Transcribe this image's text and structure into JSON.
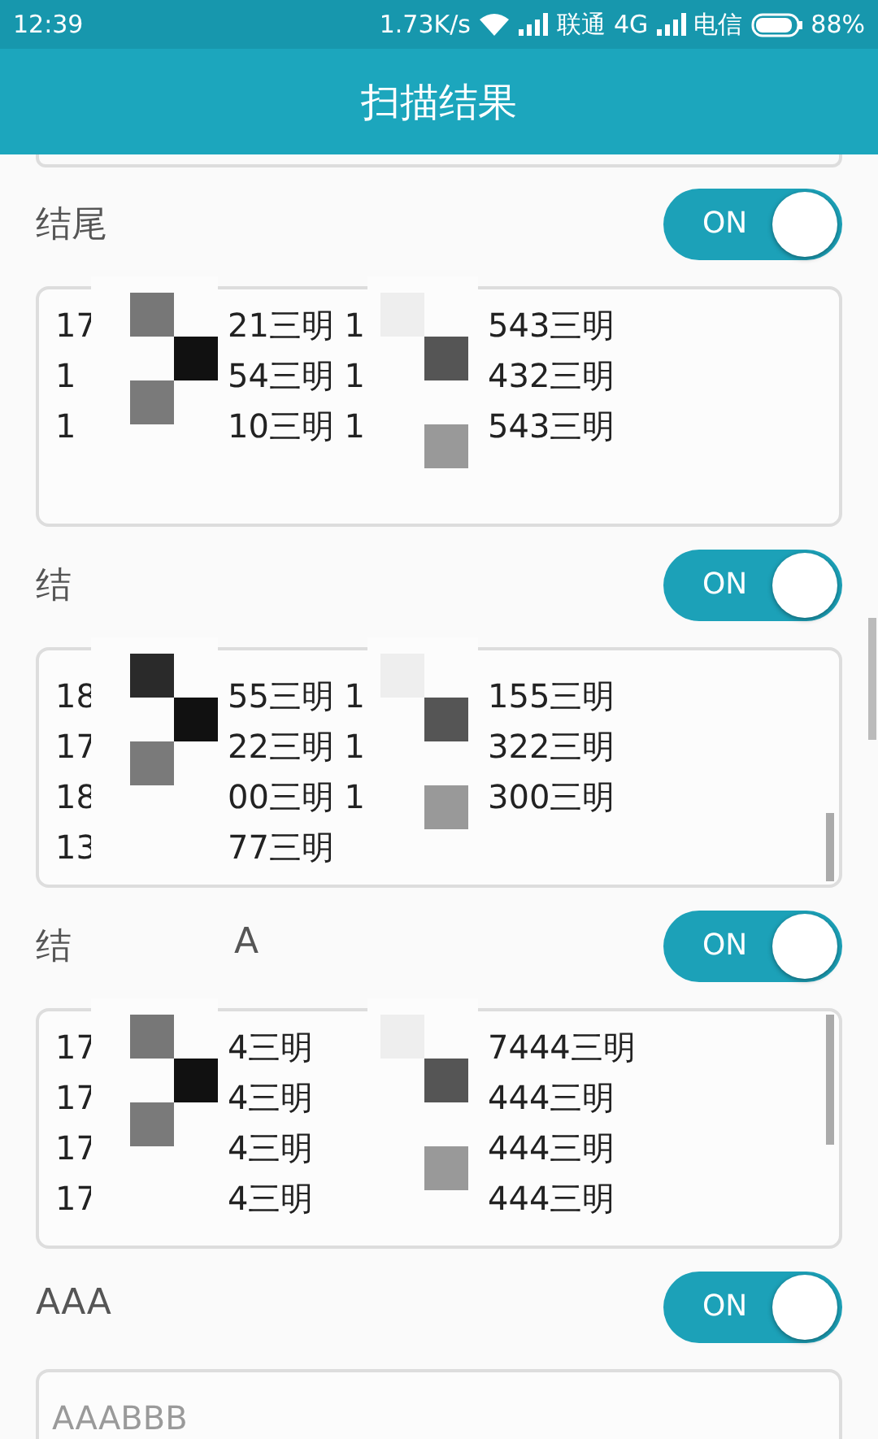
{
  "status_bar": {
    "time": "12:39",
    "speed": "1.73K/s",
    "carrier_1": "联通",
    "network": "4G",
    "carrier_2": "电信",
    "battery": "88%"
  },
  "header": {
    "title": "扫描结果"
  },
  "sections": [
    {
      "label": [
        "结尾"
      ],
      "toggle": {
        "text": "ON",
        "on": true
      },
      "kind": "list",
      "rows": [
        [
          "17",
          "21三明 1",
          "543三明"
        ],
        [
          "1",
          "54三明 1",
          "432三明"
        ],
        [
          "1",
          "10三明 1",
          "543三明"
        ]
      ]
    },
    {
      "label": [
        "结"
      ],
      "toggle": {
        "text": "ON",
        "on": true
      },
      "kind": "list",
      "rows": [
        [
          "18",
          "55三明 1",
          "155三明"
        ],
        [
          "17",
          "22三明 1",
          "322三明"
        ],
        [
          "18",
          "00三明 1",
          "300三明"
        ],
        [
          "13",
          "77三明"
        ]
      ]
    },
    {
      "label": [
        "结",
        "A"
      ],
      "toggle": {
        "text": "ON",
        "on": true
      },
      "kind": "list",
      "rows": [
        [
          "17",
          "4三明",
          "7444三明"
        ],
        [
          "17",
          "4三明",
          "444三明"
        ],
        [
          "17",
          "4三明",
          "444三明"
        ],
        [
          "17",
          "4三明",
          "444三明"
        ]
      ]
    },
    {
      "label": [
        "AAA"
      ],
      "toggle": {
        "text": "ON",
        "on": true
      },
      "kind": "field",
      "placeholder": "AAABBB"
    }
  ]
}
